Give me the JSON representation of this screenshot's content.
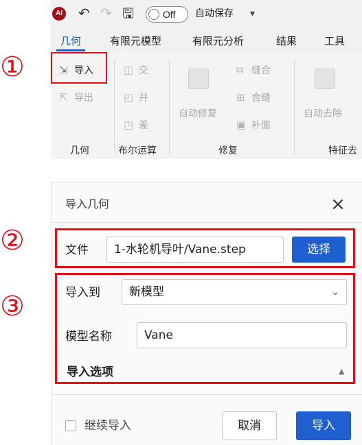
{
  "steps": [
    "①",
    "②",
    "③"
  ],
  "quick_access": {
    "logo_text": "AI",
    "toggle_text": "Off",
    "autosave_label": "自动保存",
    "more": "▾"
  },
  "tabs": [
    "几何",
    "有限元模型",
    "有限元分析",
    "结果",
    "工具"
  ],
  "ribbon": {
    "geometry_group": {
      "import": "导入",
      "export": "导出",
      "label": "几何"
    },
    "boolean_group": {
      "intersect": "交",
      "union": "并",
      "subtract": "差",
      "label": "布尔运算"
    },
    "repair_group": {
      "auto_repair": "自动修复",
      "sew": "缝合",
      "merge_seams": "合缝",
      "patch": "补面",
      "label": "修复"
    },
    "feature_group": {
      "auto_remove": "自动去除",
      "label": "特征去"
    }
  },
  "dialog": {
    "title": "导入几何",
    "close_icon": "×",
    "file_label": "文件",
    "file_value": "1-水轮机导叶/Vane.step",
    "select_button": "选择",
    "import_to_label": "导入到",
    "import_to_value": "新模型",
    "model_name_label": "模型名称",
    "model_name_value": "Vane",
    "options_title": "导入选项",
    "continue_label": "继续导入",
    "cancel_button": "取消",
    "import_button": "导入"
  },
  "colors": {
    "accent": "#1f5fcf",
    "highlight": "#e0101a"
  }
}
